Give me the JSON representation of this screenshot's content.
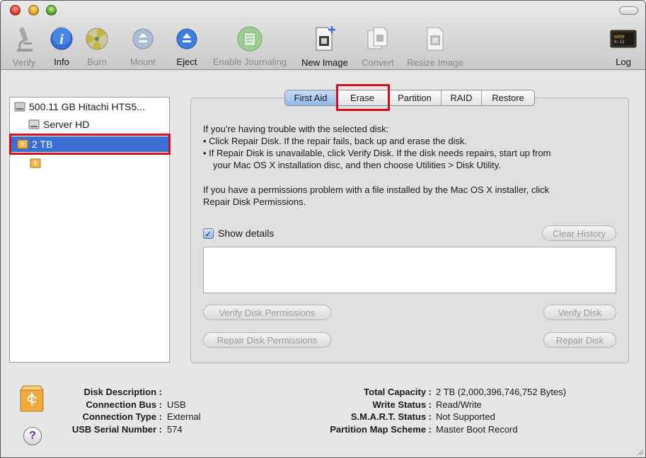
{
  "toolbar": {
    "items": [
      {
        "label": "Verify",
        "icon": "microscope-icon",
        "enabled": false
      },
      {
        "label": "Info",
        "icon": "info-icon",
        "enabled": true
      },
      {
        "label": "Burn",
        "icon": "burn-icon",
        "enabled": false
      },
      {
        "label": "Mount",
        "icon": "mount-icon",
        "enabled": false
      },
      {
        "label": "Eject",
        "icon": "eject-icon",
        "enabled": true
      },
      {
        "label": "Enable Journaling",
        "icon": "journaling-icon",
        "enabled": false
      },
      {
        "label": "New Image",
        "icon": "new-image-icon",
        "enabled": true
      },
      {
        "label": "Convert",
        "icon": "convert-icon",
        "enabled": false
      },
      {
        "label": "Resize Image",
        "icon": "resize-image-icon",
        "enabled": false
      },
      {
        "label": "Log",
        "icon": "log-icon",
        "enabled": true
      }
    ]
  },
  "sidebar": {
    "items": [
      {
        "label": "500.11 GB Hitachi HTS5..."
      },
      {
        "label": "Server HD"
      },
      {
        "label": "2 TB"
      },
      {
        "label": ""
      }
    ]
  },
  "tabs": [
    {
      "label": "First Aid"
    },
    {
      "label": "Erase"
    },
    {
      "label": "Partition"
    },
    {
      "label": "RAID"
    },
    {
      "label": "Restore"
    }
  ],
  "first_aid": {
    "intro": "If you’re having trouble with the selected disk:",
    "bullet1": "• Click Repair Disk. If the repair fails, back up and erase the disk.",
    "bullet2": "• If Repair Disk is unavailable, click Verify Disk. If the disk needs repairs, start up from",
    "bullet2b": "your Mac OS X installation disc, and then choose Utilities > Disk Utility.",
    "perm1": "If you have a permissions problem with a file installed by the Mac OS X installer, click",
    "perm2": "Repair Disk Permissions.",
    "show_details": "Show details",
    "check_mark": "✓",
    "clear_history": "Clear History",
    "verify_permissions": "Verify Disk Permissions",
    "verify_disk": "Verify Disk",
    "repair_permissions": "Repair Disk Permissions",
    "repair_disk": "Repair Disk"
  },
  "info": {
    "left_labels": [
      "Disk Description :",
      "Connection Bus :",
      "Connection Type :",
      "USB Serial Number :"
    ],
    "left_values": [
      "",
      "USB",
      "External",
      "574"
    ],
    "right_labels": [
      "Total Capacity :",
      "Write Status :",
      "S.M.A.R.T. Status :",
      "Partition Map Scheme :"
    ],
    "right_values": [
      "2 TB (2,000,396,746,752 Bytes)",
      "Read/Write",
      "Not Supported",
      "Master Boot Record"
    ]
  },
  "help_label": "?"
}
